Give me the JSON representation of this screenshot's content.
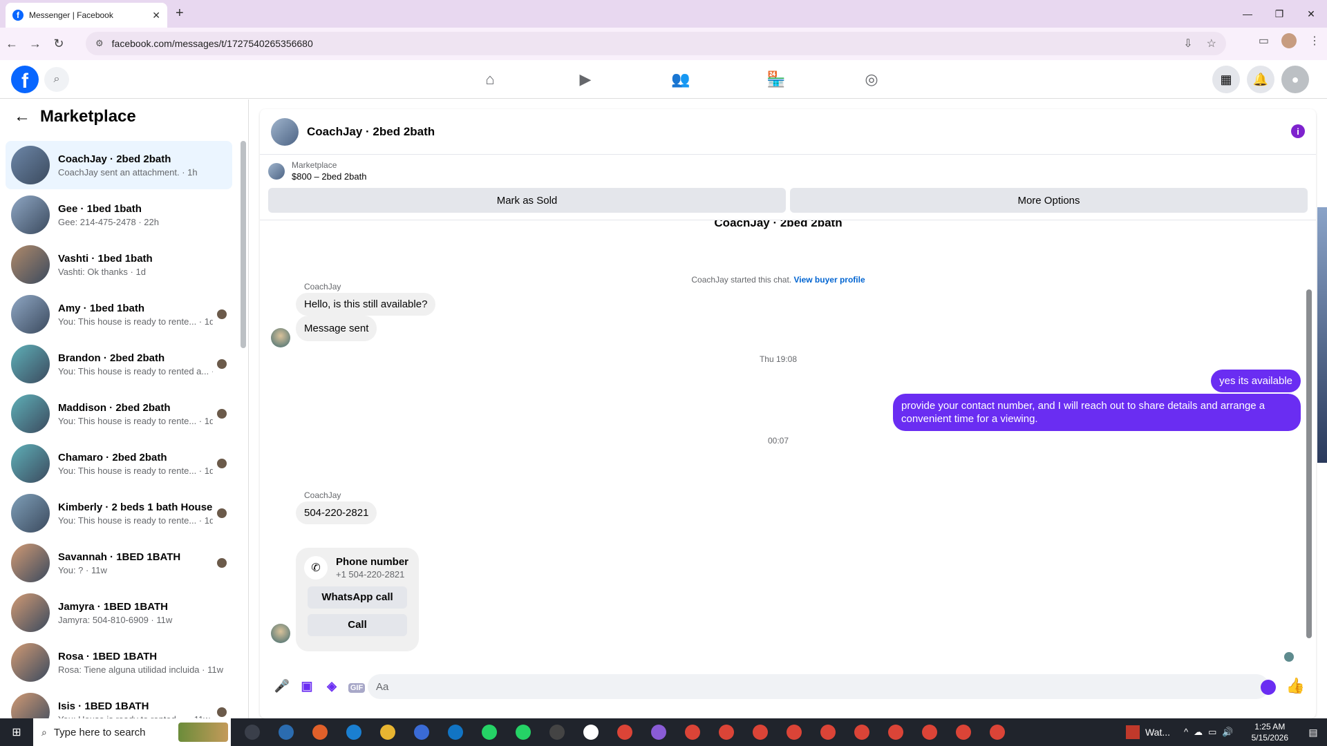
{
  "browser": {
    "tab_title": "Messenger | Facebook",
    "url": "facebook.com/messages/t/1727540265356680"
  },
  "sidebar": {
    "title": "Marketplace",
    "conversations": [
      {
        "name": "CoachJay · 2bed 2bath",
        "snippet": "CoachJay sent an attachment. · 1h",
        "active": true,
        "color": "#6d87a8"
      },
      {
        "name": "Gee · 1bed 1bath",
        "snippet": "Gee: 214-475-2478 · 22h",
        "color": "#8fa7c4"
      },
      {
        "name": "Vashti · 1bed 1bath",
        "snippet": "Vashti: Ok thanks · 1d",
        "color": "#b08a6a"
      },
      {
        "name": "Amy · 1bed 1bath",
        "snippet": "You: This house is ready to rente... · 1d",
        "color": "#8fa7c4"
      },
      {
        "name": "Brandon · 2bed 2bath",
        "snippet": "You: This house is ready to rented a... · 1d",
        "color": "#5fb0b8"
      },
      {
        "name": "Maddison · 2bed 2bath",
        "snippet": "You: This house is ready to rente... · 1d",
        "color": "#5fb0b8"
      },
      {
        "name": "Chamaro · 2bed 2bath",
        "snippet": "You: This house is ready to rente... · 1d",
        "color": "#5fb0b8"
      },
      {
        "name": "Kimberly · 2 beds 1 bath House",
        "snippet": "You: This house is ready to rente... · 1d",
        "color": "#7f9fb8"
      },
      {
        "name": "Savannah · 1BED 1BATH",
        "snippet": "You: ? · 11w",
        "color": "#d19a74"
      },
      {
        "name": "Jamyra · 1BED 1BATH",
        "snippet": "Jamyra: 504-810-6909 · 11w",
        "color": "#d19a74"
      },
      {
        "name": "Rosa · 1BED 1BATH",
        "snippet": "Rosa: Tiene alguna utilidad incluida · 11w",
        "color": "#d19a74"
      },
      {
        "name": "Isis · 1BED 1BATH",
        "snippet": "You: House is ready to rented ... · 11w",
        "color": "#d19a74"
      }
    ]
  },
  "chat": {
    "title": "CoachJay · 2bed 2bath",
    "listing_source": "Marketplace",
    "listing_price": "$800 – 2bed 2bath",
    "mark_sold": "Mark as Sold",
    "more_options": "More Options",
    "started_text": "CoachJay started this chat.",
    "buyer_profile": "View buyer profile",
    "sender": "CoachJay",
    "msg1": "Hello, is this still available?",
    "msg2": "Message sent",
    "time1": "Thu 19:08",
    "out1": "yes its available",
    "out2": "provide your contact number, and I will reach out to share details and arrange a convenient time for a viewing.",
    "time2": "00:07",
    "msg3": "504-220-2821",
    "phone_title": "Phone number",
    "phone_value": "+1 504-220-2821",
    "whatsapp": "WhatsApp call",
    "call": "Call",
    "composer_placeholder": "Aa",
    "composer_gif": "GIF"
  },
  "taskbar": {
    "search": "Type here to search",
    "weather": "Wat...",
    "time": "1:25 AM",
    "date": "5/15/2026"
  }
}
